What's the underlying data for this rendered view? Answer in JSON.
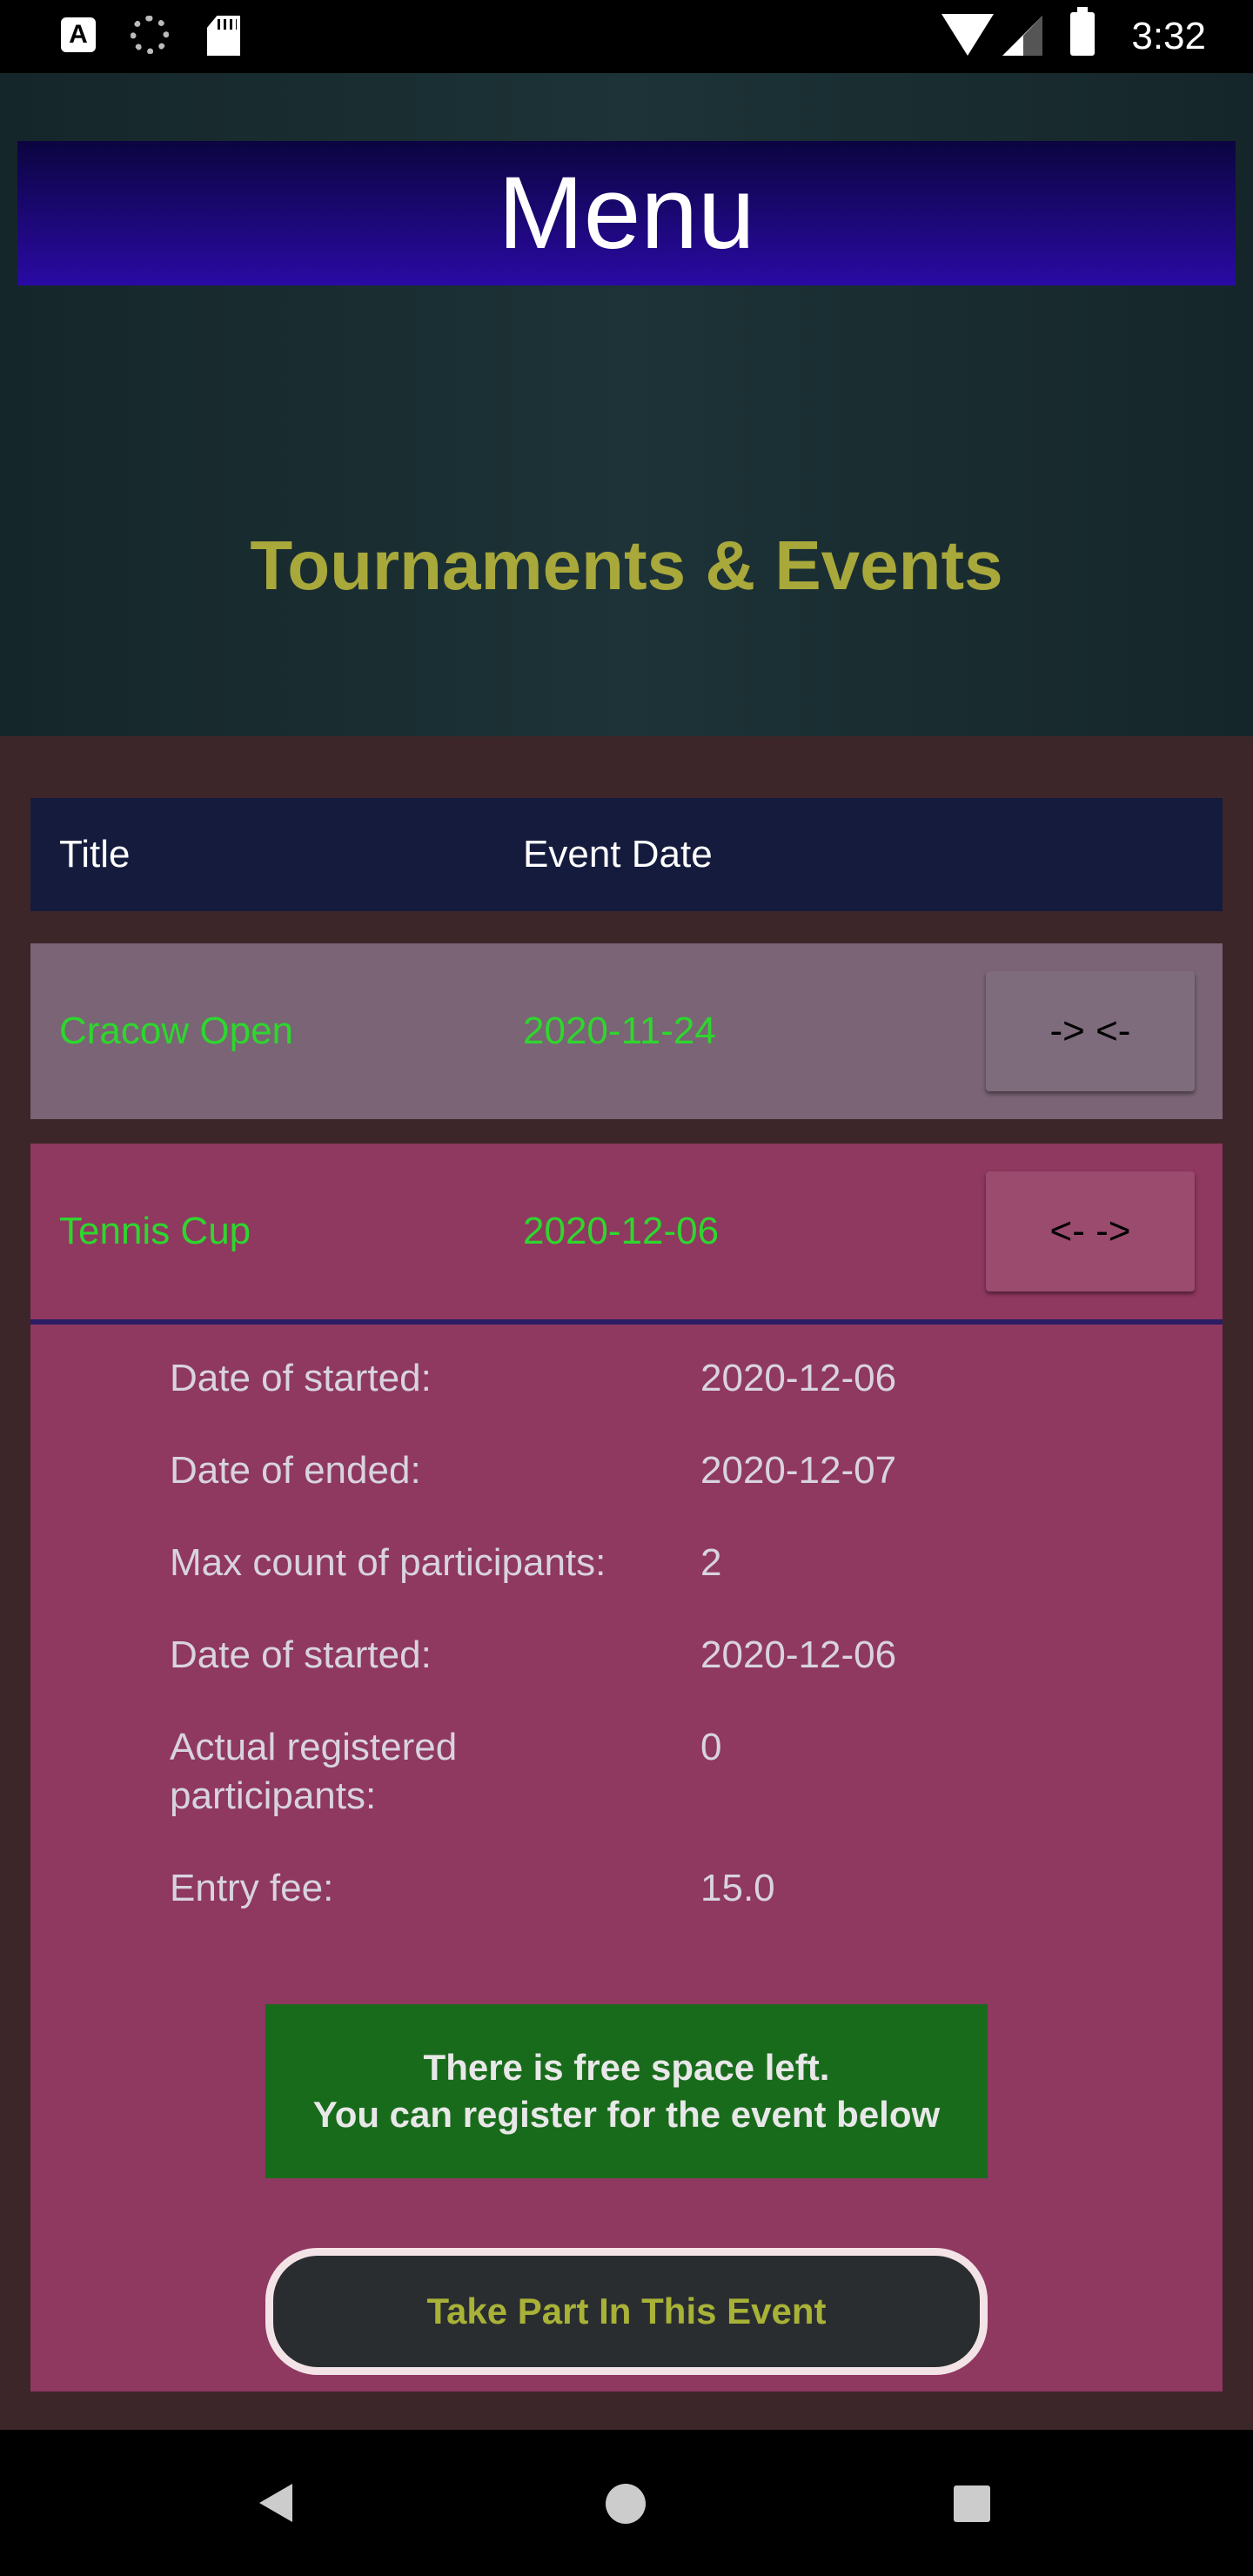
{
  "status_bar": {
    "time": "3:32",
    "icons": [
      "a-icon",
      "spinner-icon",
      "sd-card-icon",
      "wifi-icon",
      "signal-icon",
      "battery-icon"
    ]
  },
  "header": {
    "menu_label": "Menu",
    "page_title": "Tournaments & Events"
  },
  "table": {
    "columns": {
      "title": "Title",
      "event_date": "Event Date"
    },
    "rows": [
      {
        "title": "Cracow Open",
        "date": "2020-11-24",
        "toggle_label": "-> <-"
      },
      {
        "title": "Tennis Cup",
        "date": "2020-12-06",
        "toggle_label": "<- ->"
      }
    ]
  },
  "details": {
    "fields": [
      {
        "label": "Date of started:",
        "value": "2020-12-06"
      },
      {
        "label": "Date of ended:",
        "value": "2020-12-07"
      },
      {
        "label": "Max count of participants:",
        "value": "2"
      },
      {
        "label": "Date of started:",
        "value": "2020-12-06"
      },
      {
        "label": "Actual registered participants:",
        "value": "0"
      },
      {
        "label": "Entry fee:",
        "value": "15.0"
      }
    ],
    "notice_line1": "There is free space left.",
    "notice_line2": "You can register for the event below",
    "take_part_label": "Take Part In This Event"
  },
  "nav_bar": {
    "icons": [
      "back-icon",
      "home-icon",
      "recents-icon"
    ]
  },
  "colors": {
    "accent_green": "#2ed62e",
    "title_olive": "#a8a83b",
    "menu_blue": "#2a0aa4"
  }
}
